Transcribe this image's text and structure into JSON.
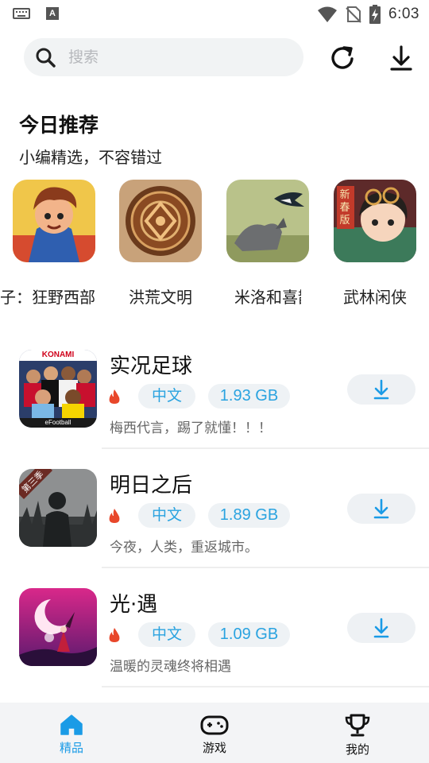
{
  "status_bar": {
    "time": "6:03",
    "icons": [
      "keyboard-icon",
      "a-icon",
      "wifi-icon",
      "no-sim-icon",
      "battery-charging-icon"
    ]
  },
  "header": {
    "search_placeholder": "搜索",
    "icons": [
      "search-icon",
      "refresh-icon",
      "download-icon"
    ]
  },
  "recommend": {
    "title": "今日推荐",
    "subtitle": "小编精选，不容错过",
    "items": [
      {
        "name": "孩子：狂野西部"
      },
      {
        "name": "洪荒文明"
      },
      {
        "name": "米洛和喜鹊"
      },
      {
        "name": "武林闲侠"
      }
    ]
  },
  "apps": [
    {
      "title": "实况足球",
      "lang": "中文",
      "size": "1.93 GB",
      "desc": "梅西代言，踢了就懂！！！",
      "thumb_text": [
        "KONAMI",
        "eFootball"
      ]
    },
    {
      "title": "明日之后",
      "lang": "中文",
      "size": "1.89 GB",
      "desc": "今夜，人类，重返城市。",
      "thumb_text": [
        "第三季"
      ]
    },
    {
      "title": "光·遇",
      "lang": "中文",
      "size": "1.09 GB",
      "desc": "温暖的灵魂终将相遇",
      "thumb_text": []
    }
  ],
  "thumb_badges": {
    "wulin": "新春版"
  },
  "bottom_nav": {
    "items": [
      {
        "label": "精品",
        "icon": "home-icon",
        "active": true
      },
      {
        "label": "游戏",
        "icon": "gamepad-icon",
        "active": false
      },
      {
        "label": "我的",
        "icon": "trophy-icon",
        "active": false
      }
    ]
  },
  "colors": {
    "accent": "#1a9be6",
    "tag_bg": "#eef2f5",
    "tag_text": "#2aa3e0",
    "fire": "#e8472b"
  }
}
